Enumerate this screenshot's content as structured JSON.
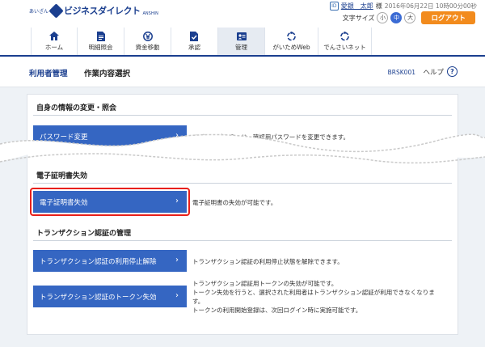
{
  "header": {
    "logo_prefix": "あいざん",
    "logo_text": "ビジネスダイレクト",
    "logo_sub": "ANSHIN",
    "user_icon_label": "ID",
    "user_name": "愛銀　太郎",
    "user_honorific": "様",
    "login_time": "2016年06月22日 10時00分00秒",
    "font_size_label": "文字サイズ",
    "font_sizes": [
      "小",
      "中",
      "大"
    ],
    "font_size_selected": "中",
    "logout_label": "ログアウト"
  },
  "nav": {
    "items": [
      {
        "label": "ホーム",
        "icon": "home-icon"
      },
      {
        "label": "明細照会",
        "icon": "document-icon"
      },
      {
        "label": "資金移動",
        "icon": "yen-icon"
      },
      {
        "label": "承認",
        "icon": "approval-icon"
      },
      {
        "label": "管理",
        "icon": "manage-icon",
        "active": true
      },
      {
        "label": "がいためWeb",
        "icon": "link-icon"
      },
      {
        "label": "でんさいネット",
        "icon": "link-icon"
      }
    ]
  },
  "subheader": {
    "category": "利用者管理",
    "title": "作業内容選択",
    "code": "BRSK001",
    "help_label": "ヘルプ",
    "help_icon_glyph": "?"
  },
  "sections": [
    {
      "title": "自身の情報の変更・照会",
      "rows": [
        {
          "button": "パスワード変更",
          "desc": [
            "ログインパスワード、確認用パスワードを変更できます。"
          ]
        }
      ]
    },
    {
      "title": "電子証明書失効",
      "rows": [
        {
          "button": "電子証明書失効",
          "desc": [
            "電子証明書の失効が可能です。"
          ]
        }
      ]
    },
    {
      "title": "トランザクション認証の管理",
      "rows": [
        {
          "button": "トランザクション認証の利用停止解除",
          "desc": [
            "トランザクション認証の利用停止状態を解除できます。"
          ]
        },
        {
          "button": "トランザクション認証のトークン失効",
          "desc": [
            "トランザクション認証用トークンの失効が可能です。",
            "トークン失効を行うと、選択された利用者はトランザクション認証が利用できなくなりま",
            "す。",
            "トークンの利用開始登録は、次回ログイン時に実施可能です。"
          ]
        }
      ]
    }
  ],
  "colors": {
    "brand": "#1b3f8f",
    "button": "#3566c2",
    "logout": "#f28b1d",
    "highlight": "#e8201a"
  }
}
